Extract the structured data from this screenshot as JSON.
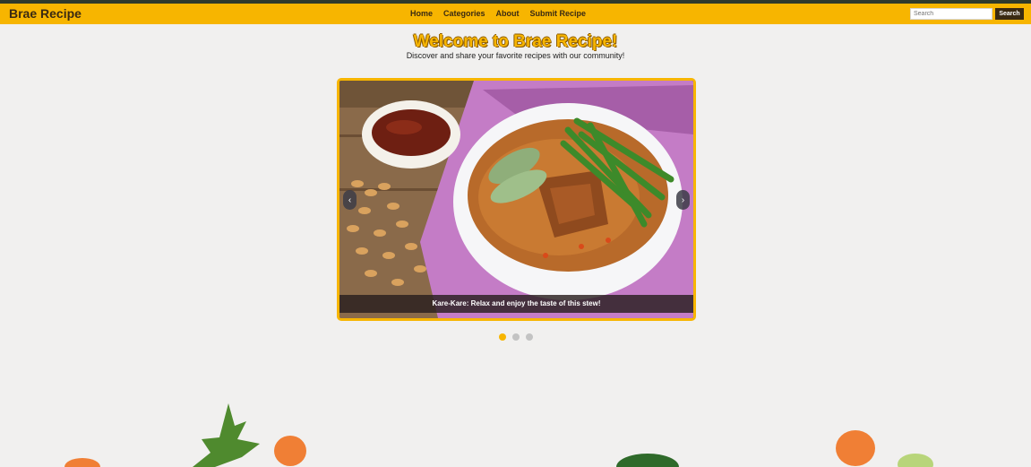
{
  "brand": {
    "name": "Brae Recipe"
  },
  "nav": {
    "items": [
      {
        "label": "Home"
      },
      {
        "label": "Categories"
      },
      {
        "label": "About"
      },
      {
        "label": "Submit Recipe"
      }
    ]
  },
  "search": {
    "placeholder": "Search",
    "button_label": "Search"
  },
  "hero": {
    "title": "Welcome to Brae Recipe!",
    "subtitle": "Discover and share your favorite recipes with our community!"
  },
  "carousel": {
    "caption": "Kare-Kare: Relax and enjoy the taste of this stew!",
    "prev_icon": "chevron-left-icon",
    "next_icon": "chevron-right-icon",
    "slide_count": 3,
    "active_index": 0
  },
  "colors": {
    "accent": "#f7b500",
    "dark": "#3a2a12",
    "background": "#f1f0ef"
  }
}
